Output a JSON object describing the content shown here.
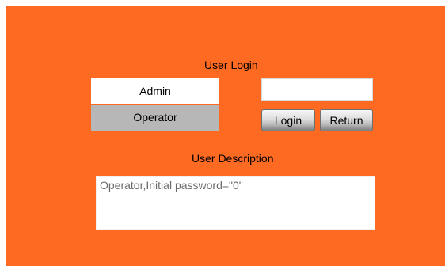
{
  "colors": {
    "background": "#ff6a22",
    "selected_user_bg": "#b7b7b7",
    "user_bg": "#ffffff",
    "description_text": "#6b6b6b"
  },
  "login": {
    "title": "User Login",
    "users": [
      {
        "label": "Admin",
        "selected": false
      },
      {
        "label": "Operator",
        "selected": true
      }
    ],
    "password_value": "",
    "login_label": "Login",
    "return_label": "Return"
  },
  "description": {
    "title": "User Description",
    "text": "Operator,Initial password=\"0\""
  }
}
